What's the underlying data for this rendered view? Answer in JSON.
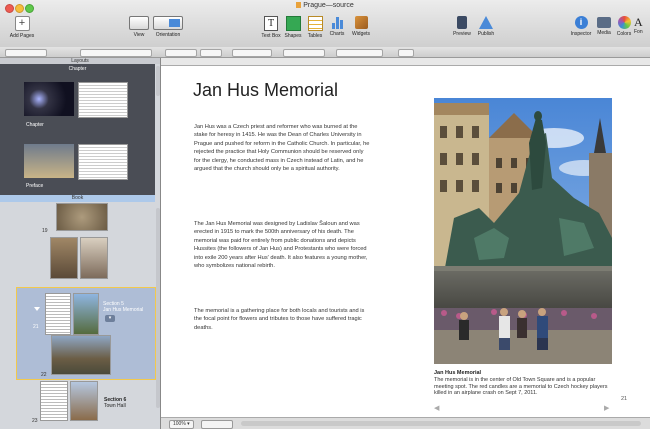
{
  "window": {
    "title": "Prague—source"
  },
  "toolbar": {
    "items": [
      {
        "label": "Add Pages"
      },
      {
        "label": "View"
      },
      {
        "label": "Orientation"
      },
      {
        "label": "Text Box"
      },
      {
        "label": "Shapes"
      },
      {
        "label": "Tables"
      },
      {
        "label": "Charts"
      },
      {
        "label": "Widgets"
      },
      {
        "label": "Preview"
      },
      {
        "label": "Publish"
      },
      {
        "label": "Inspector"
      },
      {
        "label": "Media"
      },
      {
        "label": "Colors"
      },
      {
        "label": "Fon"
      }
    ]
  },
  "sidebar": {
    "header": "Layouts",
    "chapter_zone_label": "Chapter",
    "layouts": [
      {
        "label": "Chapter"
      },
      {
        "label": "Preface"
      }
    ],
    "book_label": "Book",
    "pages": [
      {
        "number": "19"
      },
      {
        "number": "20"
      },
      {
        "number": "21",
        "section": "Section 5",
        "title": "Jan Hus Memorial"
      },
      {
        "number": "22"
      },
      {
        "number": "23",
        "section": "Section 6",
        "title": "Town Hall"
      }
    ]
  },
  "document": {
    "heading": "Jan Hus Memorial",
    "paragraphs": [
      "Jan Hus was a Czech priest and reformer who was burned at the stake for heresy in 1415. He was the Dean of Charles University in Prague and pushed for reform in the Catholic Church. In particular, he rejected the practice that Holy Communion should be reserved only for the clergy, he conducted mass in Czech instead of Latin, and he argued that the church should only be a spiritual authority.",
      "The Jan Hus Memorial was designed by Ladislav Šaloun and was erected in 1915 to mark the 500th anniversary of his death. The memorial was paid for entirely from public donations and depicts Hussites (the followers of Jan Hus) and Protestants who were forced into exile 200 years after Hus' death. It also features a young mother, who symbolizes national rebirth.",
      "The memorial is a gathering place for both locals and tourists and is the focal point for flowers and tributes to those have suffered tragic deaths."
    ],
    "caption_title": "Jan Hus Memorial",
    "caption_body": "The memorial is in the center of Old Town Square and is a popular meeting spot. The red candles are a memorial to Czech hockey players killed in an airplane crash on Sept 7, 2011.",
    "page_number": "21"
  },
  "statusbar": {
    "zoom": "100%"
  },
  "colors": {
    "accent": "#3b82d6",
    "selection": "#f2c94c",
    "book_bar": "#adc9ea"
  }
}
